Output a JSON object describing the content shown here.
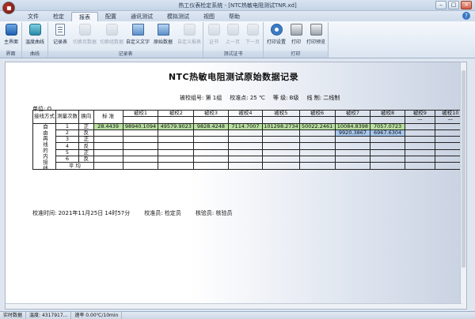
{
  "window": {
    "title": "热工仪表检定系统 - [NTC热敏电阻测试TNR.xd]"
  },
  "menu": {
    "items": [
      "文件",
      "检定",
      "报表",
      "配置",
      "通讯测试",
      "模拟测试",
      "视图",
      "帮助"
    ],
    "active": "报表"
  },
  "ribbon": {
    "groups": [
      {
        "label": "界面",
        "buttons": [
          "主界面"
        ]
      },
      {
        "label": "曲线",
        "buttons": [
          "温度曲线"
        ]
      },
      {
        "label": "记录表",
        "buttons": [
          "记录表",
          "切换页数据",
          "切换组数据",
          "自定义文字",
          "原始数据",
          "自定义报表"
        ]
      },
      {
        "label": "测试证书",
        "buttons": [
          "证书",
          "上一页",
          "下一页"
        ]
      },
      {
        "label": "打印",
        "buttons": [
          "打印设置",
          "打印",
          "打印预览"
        ]
      }
    ]
  },
  "report": {
    "title": "NTC热敏电阻测试原始数据记录",
    "info": {
      "group": "被校组号: 第 1组",
      "temp": "校准点:  25  ℃",
      "grade": "等  级: B级",
      "wiring": "线  制: 二线制"
    },
    "unit": "单位:  Ω",
    "headers": {
      "wiring_method": "接线方式",
      "count": "测量次数",
      "direction": "换向",
      "standard": "标  准"
    },
    "columns": [
      "被校1",
      "被校2",
      "被校3",
      "被校4",
      "被校5",
      "被校6",
      "被校7",
      "被校8",
      "被校9",
      "被校10"
    ],
    "dashes": [
      "—",
      "—"
    ],
    "wiring_label": "自由再线的内接线",
    "rows": [
      {
        "n": "1",
        "dir": "正",
        "std": "28.4439",
        "vals": [
          "98940.1094",
          "49579.9023",
          "9828.4248",
          "7114.7007",
          "101298.2734",
          "50022.2461",
          "10084.8398",
          "7057.0723",
          "",
          ""
        ]
      },
      {
        "n": "2",
        "dir": "反",
        "std": "",
        "vals": [
          "",
          "",
          "",
          "",
          "",
          "",
          "9920.3867",
          "6967.6304",
          "",
          ""
        ]
      },
      {
        "n": "3",
        "dir": "正",
        "std": "",
        "vals": [
          "",
          "",
          "",
          "",
          "",
          "",
          "",
          "",
          "",
          ""
        ]
      },
      {
        "n": "4",
        "dir": "反",
        "std": "",
        "vals": [
          "",
          "",
          "",
          "",
          "",
          "",
          "",
          "",
          "",
          ""
        ]
      },
      {
        "n": "5",
        "dir": "正",
        "std": "",
        "vals": [
          "",
          "",
          "",
          "",
          "",
          "",
          "",
          "",
          "",
          ""
        ]
      },
      {
        "n": "6",
        "dir": "反",
        "std": "",
        "vals": [
          "",
          "",
          "",
          "",
          "",
          "",
          "",
          "",
          "",
          ""
        ]
      }
    ],
    "avg_label": "平 均",
    "footer": {
      "time": "校准时间:   2021年11月25日 14时57分",
      "calibrator": "校准员:  检定员",
      "verifier": "核验员:  核验员"
    }
  },
  "status": {
    "items": [
      "实时数据",
      "温度: 4317917...",
      "速率  0.00℃/10min"
    ]
  }
}
